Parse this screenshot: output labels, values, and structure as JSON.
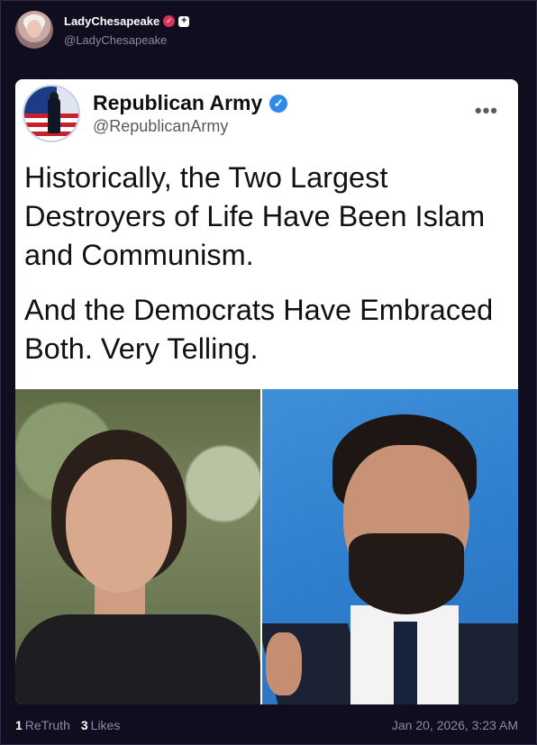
{
  "post": {
    "author": {
      "display_name": "LadyChesapeake",
      "handle": "@LadyChesapeake",
      "verified_icon": "check-badge-pink",
      "plus_icon": "plus-badge"
    },
    "media": {
      "inner_post": {
        "display_name": "Republican Army",
        "handle": "@RepublicanArmy",
        "verified_icon": "check-badge-blue",
        "more_label": "•••",
        "text_paragraph_1": "Historically, the Two Largest Destroyers of Life Have Been Islam and Communism.",
        "text_paragraph_2": "And the Democrats Have Embraced Both. Very Telling."
      }
    },
    "stats": {
      "retruths_count": "1",
      "retruths_label": "ReTruth",
      "likes_count": "3",
      "likes_label": "Likes"
    },
    "timestamp": "Jan 20, 2026, 3:23 AM"
  },
  "colors": {
    "background": "#0f0d1e",
    "muted_text": "#8d8aa6",
    "verified_pink": "#e0305c",
    "verified_blue": "#2f89e8"
  }
}
